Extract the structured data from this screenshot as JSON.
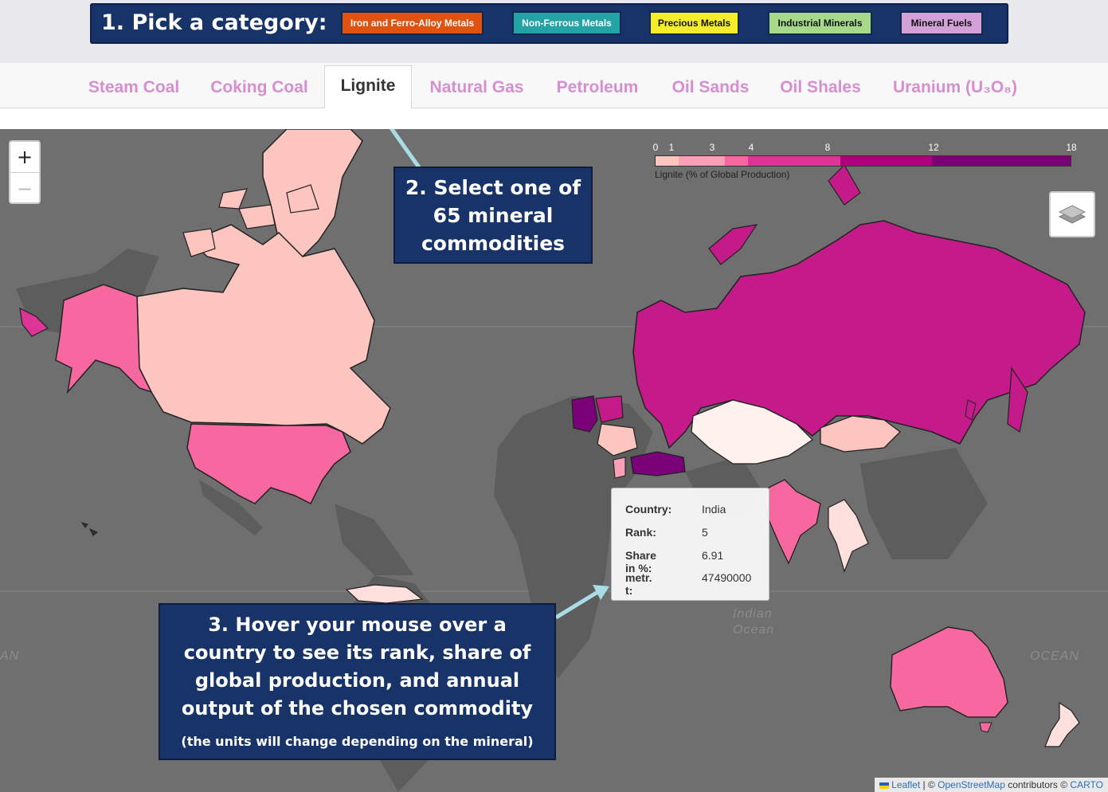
{
  "categories": {
    "label": "1. Pick a category:",
    "buttons": [
      {
        "label": "Iron and Ferro-Alloy Metals",
        "bg": "#e0520f",
        "fg": "#ffffff"
      },
      {
        "label": "Non-Ferrous Metals",
        "bg": "#23a3a6",
        "fg": "#ffffff"
      },
      {
        "label": "Precious Metals",
        "bg": "#f5ed2a",
        "fg": "#111111"
      },
      {
        "label": "Industrial Minerals",
        "bg": "#a6da8a",
        "fg": "#111111"
      },
      {
        "label": "Mineral Fuels",
        "bg": "#d3a0d8",
        "fg": "#111111"
      }
    ]
  },
  "tabs": [
    {
      "label": "Steam Coal",
      "active": false
    },
    {
      "label": "Coking Coal",
      "active": false
    },
    {
      "label": "Lignite",
      "active": true
    },
    {
      "label": "Natural Gas",
      "active": false
    },
    {
      "label": "Petroleum",
      "active": false
    },
    {
      "label": "Oil Sands",
      "active": false
    },
    {
      "label": "Oil Shales",
      "active": false
    },
    {
      "label": "Uranium (U₃O₈)",
      "active": false
    }
  ],
  "map": {
    "zoom_in": "+",
    "zoom_out": "−",
    "layers_icon": "layers-icon",
    "ocean_labels": [
      "Indian",
      "Ocean",
      "AN",
      "OCEAN"
    ],
    "legend": {
      "ticks": [
        "0",
        "1",
        "3",
        "4",
        "8",
        "12",
        "18"
      ],
      "title": "Lignite (% of Global Production)",
      "colors": [
        "#fde0dd",
        "#fcc5c0",
        "#fa9fb5",
        "#f768a1",
        "#dd3497",
        "#ae017e",
        "#7a0177"
      ]
    },
    "tooltip": {
      "country_key": "Country:",
      "country": "India",
      "rank_key": "Rank:",
      "rank": "5",
      "share_key": "Share in %:",
      "share": "6.91",
      "unit_key": "metr. t:",
      "value": "47490000"
    },
    "attribution": {
      "leaflet": "Leaflet",
      "sep": " | © ",
      "osm": "OpenStreetMap",
      "contrib": " contributors © ",
      "carto": "CARTO"
    }
  },
  "callouts": {
    "step2": "2. Select one of 65 mineral commodities",
    "step3": "3. Hover your mouse over a country to see its rank, share of global production, and annual output of the chosen commodity",
    "step3_note": "(the units will change depending on the mineral)"
  },
  "colors": {
    "navy": "#173367",
    "arrow": "#a9dde6",
    "map_bg": "#6f6f6f",
    "land": "#5c5c5c"
  }
}
